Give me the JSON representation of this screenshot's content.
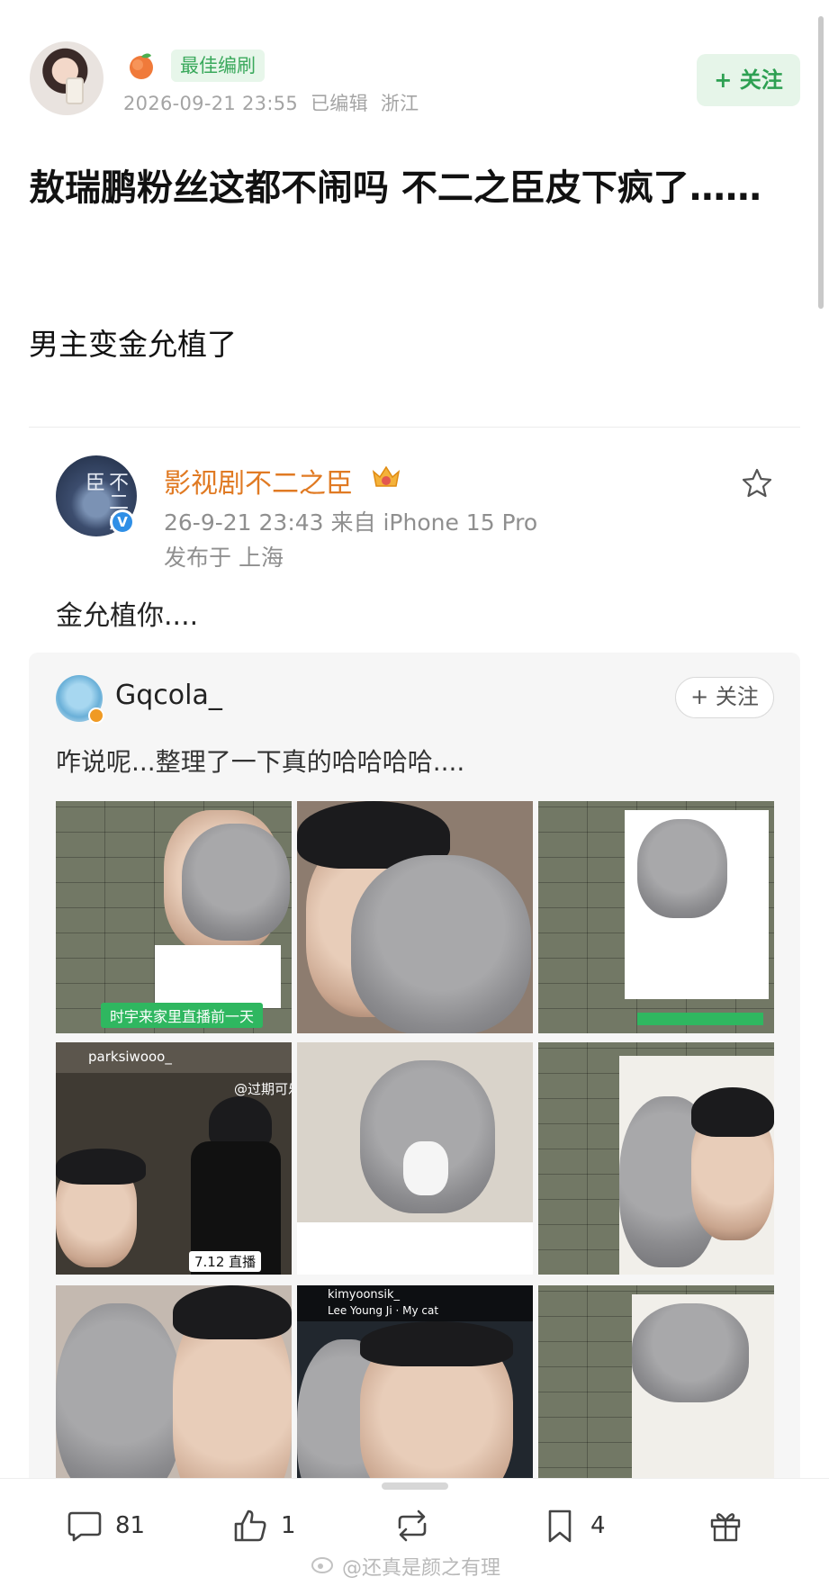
{
  "post": {
    "badge": "最佳编刷",
    "date": "2026-09-21 23:55",
    "edited": "已编辑",
    "location": "浙江",
    "follow_label": "+ 关注",
    "title": "敖瑞鹏粉丝这都不闹吗 不二之臣皮下疯了……",
    "body": "男主变金允植了"
  },
  "repost": {
    "name": "影视剧不二之臣",
    "avatar_text": "不二之臣",
    "meta": "26-9-21 23:43  来自 iPhone 15 Pro",
    "location": "发布于 上海",
    "text": "金允植你...."
  },
  "quoted": {
    "name": "Gqcola_",
    "follow_label": "+ 关注",
    "text": "咋说呢...整理了一下真的哈哈哈哈....",
    "photo_captions": {
      "p1": "时宇来家里直播前一天",
      "p4_user": "parksiwooo_",
      "p4_tag": "7.12 直播",
      "p4_watermark": "@过期可乐",
      "p8_user": "kimyoonsik_",
      "p8_song": "Lee Young Ji · My cat"
    }
  },
  "actions": {
    "comments": "81",
    "likes": "1",
    "bookmarks": "4"
  },
  "watermark": "@还真是颜之有理",
  "colors": {
    "accent_green": "#2da052",
    "name_orange": "#e07a23",
    "verified_blue": "#2f8fe6"
  }
}
